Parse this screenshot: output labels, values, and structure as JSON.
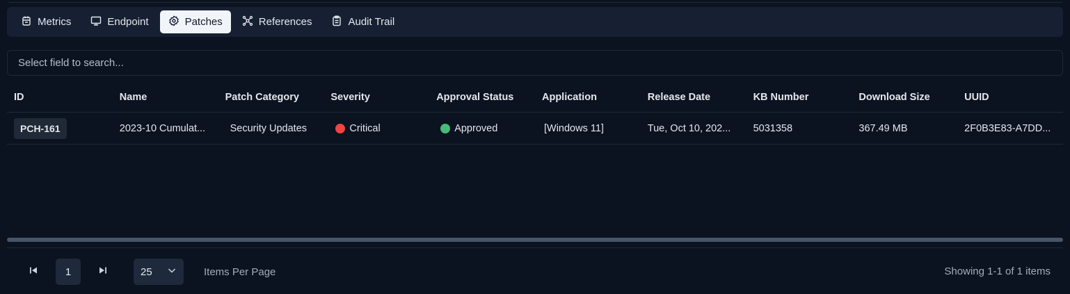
{
  "tabs": [
    {
      "label": "Metrics",
      "icon": "clipboard-calendar-icon",
      "active": false
    },
    {
      "label": "Endpoint",
      "icon": "monitor-icon",
      "active": false
    },
    {
      "label": "Patches",
      "icon": "badge-gear-icon",
      "active": true
    },
    {
      "label": "References",
      "icon": "network-nodes-icon",
      "active": false
    },
    {
      "label": "Audit Trail",
      "icon": "clipboard-list-icon",
      "active": false
    }
  ],
  "search": {
    "placeholder": "Select field to search..."
  },
  "table": {
    "columns": [
      "ID",
      "Name",
      "Patch Category",
      "Severity",
      "Approval Status",
      "Application",
      "Release Date",
      "KB Number",
      "Download Size",
      "UUID"
    ],
    "rows": [
      {
        "id": "PCH-161",
        "name": "2023-10 Cumulat...",
        "category": "Security Updates",
        "severity": "Critical",
        "severity_color": "#ef4444",
        "approval": "Approved",
        "approval_color": "#4ade80",
        "application": "[Windows 11]",
        "release_date": "Tue, Oct 10, 202...",
        "kb": "5031358",
        "size": "367.49 MB",
        "uuid": "2F0B3E83-A7DD..."
      }
    ]
  },
  "pagination": {
    "current_page": "1",
    "per_page": "25",
    "per_page_label": "Items Per Page",
    "showing": "Showing 1-1 of 1 items"
  }
}
